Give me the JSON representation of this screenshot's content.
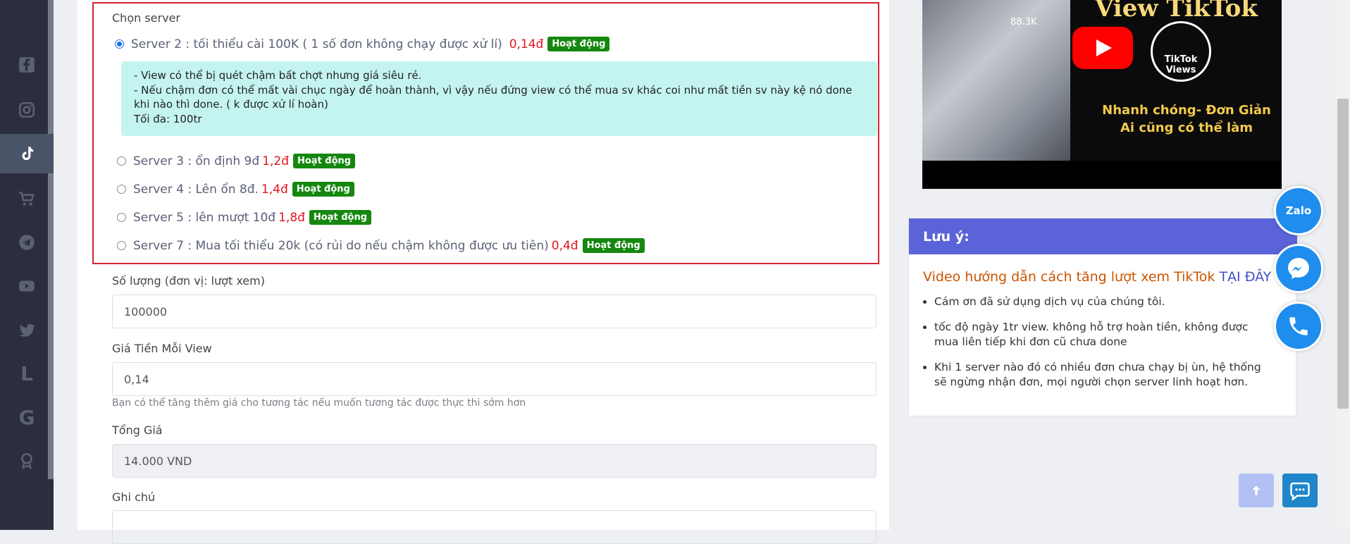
{
  "sidebar": {
    "items": [
      {
        "icon": "facebook-icon"
      },
      {
        "icon": "instagram-icon"
      },
      {
        "icon": "tiktok-icon",
        "active": true
      },
      {
        "icon": "cart-icon"
      },
      {
        "icon": "telegram-icon"
      },
      {
        "icon": "youtube-icon"
      },
      {
        "icon": "twitter-icon"
      },
      {
        "icon": "letter-l-icon",
        "text": "L"
      },
      {
        "icon": "google-icon",
        "text": "G"
      },
      {
        "icon": "award-icon"
      }
    ]
  },
  "form": {
    "server_label": "Chọn server",
    "servers": [
      {
        "label": "Server 2 : tối thiểu cài 100K ( 1 số đơn không chạy được xử lí)",
        "price": "0,14đ",
        "status": "Hoạt động",
        "selected": true
      },
      {
        "label": "Server 3 : ổn định 9đ",
        "price": "1,2đ",
        "status": "Hoạt động",
        "selected": false
      },
      {
        "label": "Server 4 : Lên ổn 8đ.",
        "price": "1,4đ",
        "status": "Hoạt động",
        "selected": false
      },
      {
        "label": "Server 5 : lên mượt 10đ",
        "price": "1,8đ",
        "status": "Hoạt động",
        "selected": false
      },
      {
        "label": "Server 7 : Mua tối thiểu 20k (có rủi do nếu chậm không được ưu tiên)",
        "price": "0,4đ",
        "status": "Hoạt động",
        "selected": false
      }
    ],
    "server_note": [
      "- View có thể bị quét chậm bất chợt nhưng giá siêu rẻ.",
      "- Nếu chậm đơn có thể mất vài chục ngày để hoàn thành, vì vậy nếu đứng view có thể mua sv khác coi như mất tiền sv này kệ nó done khi nào thì done. ( k được xử lí hoàn)",
      "Tối đa: 100tr"
    ],
    "quantity_label": "Số lượng (đơn vị: lượt xem)",
    "quantity_value": "100000",
    "price_label": "Giá Tiền Mỗi View",
    "price_value": "0,14",
    "price_hint": "Bạn có thể tăng thêm giá cho tương tác nếu muốn tương tác được thực thi sớm hơn",
    "total_label": "Tổng Giá",
    "total_value": "14.000 VND",
    "note_label": "Ghi chú",
    "note_value": ""
  },
  "video": {
    "title": "View TikTok",
    "views": "88.3K",
    "badge_line1": "TikTok",
    "badge_line2": "Views",
    "caption_line1": "Nhanh chóng- Đơn Giản",
    "caption_line2": "Ai cũng có thể làm"
  },
  "notice": {
    "header": "Lưu ý:",
    "video_text": "Video hướng dẫn cách tăng lượt xem TikTok",
    "video_link": "TẠI ĐÂY",
    "items": [
      "Cám ơn đã sử dụng dịch vụ của chúng tôi.",
      "tốc độ ngày 1tr view. không hỗ trợ hoàn tiền, không được mua liên tiếp khi đơn cũ chưa done",
      "Khi 1 server nào đó có nhiều đơn chưa chạy bị ùn, hệ thống sẽ ngừng nhận đơn, mọi người chọn server linh hoạt hơn."
    ]
  },
  "fabs": {
    "zalo": "Zalo"
  },
  "colors": {
    "sidebar_bg": "#2b2e3f",
    "active_item": "#4a5468",
    "danger_border": "#d3242f",
    "price_red": "#e1141f",
    "badge_green": "#15870f",
    "note_bg": "#c4f4f0",
    "notice_header": "#5b63d9",
    "fab_blue": "#1f8ded"
  }
}
